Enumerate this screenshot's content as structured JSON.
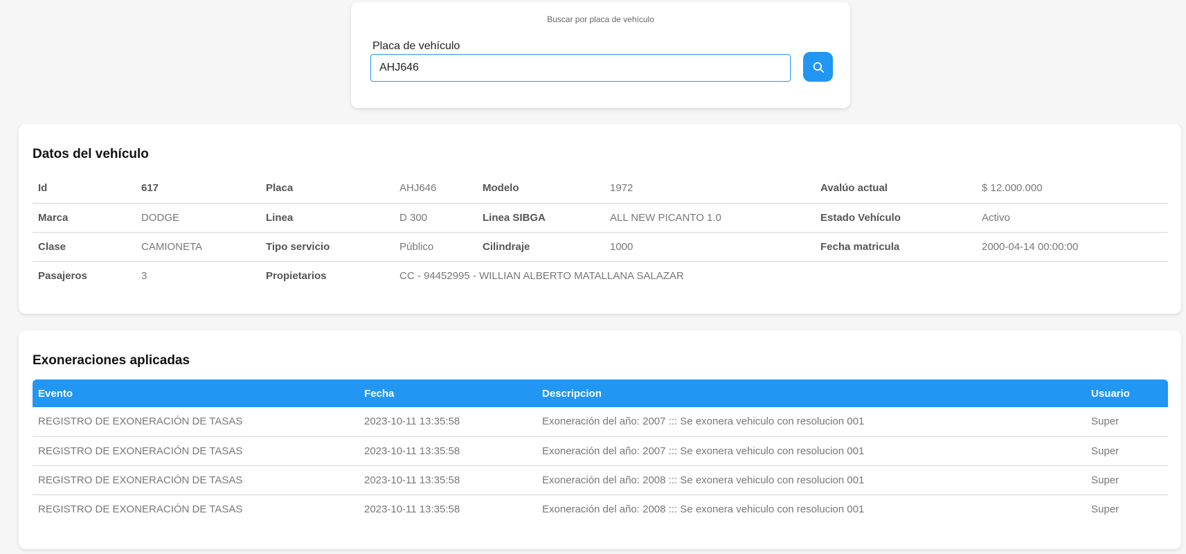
{
  "search": {
    "title": "Buscar por placa de vehículo",
    "label": "Placa de vehículo",
    "value": "AHJ646",
    "button_icon": "search-icon"
  },
  "vehicle": {
    "title": "Datos del vehículo",
    "rows": [
      [
        {
          "label": "Id",
          "value": "617",
          "value_bold": true
        },
        {
          "label": "Placa",
          "value": "AHJ646"
        },
        {
          "label": "Modelo",
          "value": "1972"
        },
        {
          "label": "Avalúo actual",
          "value": "$ 12.000.000"
        }
      ],
      [
        {
          "label": "Marca",
          "value": "DODGE"
        },
        {
          "label": "Linea",
          "value": "D 300"
        },
        {
          "label": "Linea SIBGA",
          "value": "ALL NEW PICANTO 1.0"
        },
        {
          "label": "Estado Vehículo",
          "value": "Activo"
        }
      ],
      [
        {
          "label": "Clase",
          "value": "CAMIONETA"
        },
        {
          "label": "Tipo servicio",
          "value": "Público"
        },
        {
          "label": "Cilindraje",
          "value": "1000"
        },
        {
          "label": "Fecha matricula",
          "value": "2000-04-14 00:00:00"
        }
      ],
      [
        {
          "label": "Pasajeros",
          "value": "3"
        },
        {
          "label": "Propietarios",
          "value": "CC - 94452995 - WILLIAN ALBERTO MATALLANA SALAZAR"
        }
      ]
    ]
  },
  "exoneraciones": {
    "title": "Exoneraciones aplicadas",
    "columns": [
      "Evento",
      "Fecha",
      "Descripcion",
      "Usuario"
    ],
    "rows": [
      [
        "REGISTRO DE EXONERACIÓN DE TASAS",
        "2023-10-11 13:35:58",
        "Exoneración del año: 2007 ::: Se exonera vehiculo con resolucion 001",
        "Super"
      ],
      [
        "REGISTRO DE EXONERACIÓN DE TASAS",
        "2023-10-11 13:35:58",
        "Exoneración del año: 2007 ::: Se exonera vehiculo con resolucion 001",
        "Super"
      ],
      [
        "REGISTRO DE EXONERACIÓN DE TASAS",
        "2023-10-11 13:35:58",
        "Exoneración del año: 2008 ::: Se exonera vehiculo con resolucion 001",
        "Super"
      ],
      [
        "REGISTRO DE EXONERACIÓN DE TASAS",
        "2023-10-11 13:35:58",
        "Exoneración del año: 2008 ::: Se exonera vehiculo con resolucion 001",
        "Super"
      ]
    ]
  },
  "colors": {
    "accent": "#2196f3",
    "background": "#f6f6f6"
  }
}
